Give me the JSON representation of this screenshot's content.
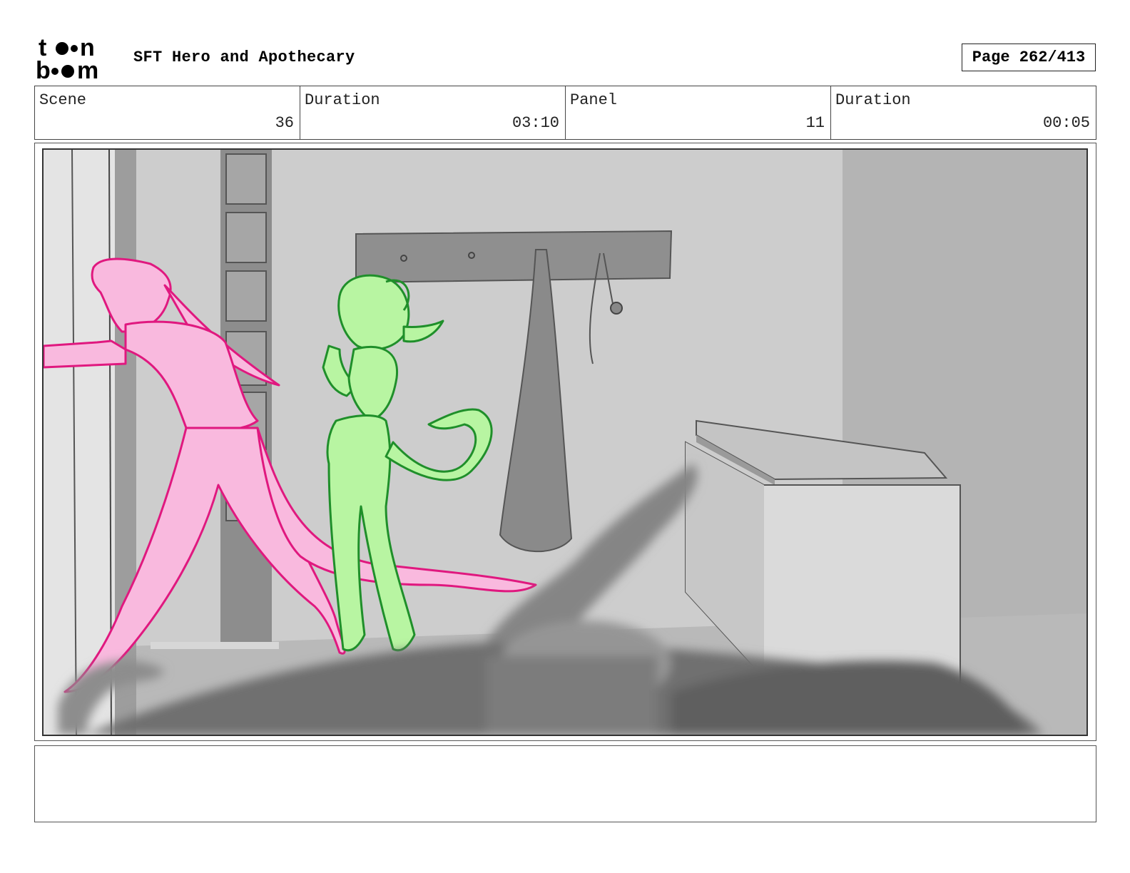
{
  "header": {
    "logo_text": "toon boom",
    "project_title": "SFT Hero and Apothecary",
    "page_label": "Page 262/413"
  },
  "info": {
    "scene_label": "Scene",
    "scene_value": "36",
    "scene_duration_label": "Duration",
    "scene_duration_value": "03:10",
    "panel_label": "Panel",
    "panel_value": "11",
    "panel_duration_label": "Duration",
    "panel_duration_value": "00:05"
  },
  "panel": {
    "colors": {
      "character_pink": "#f9b9de",
      "pink_line": "#e0187f",
      "character_green": "#b8f5a2",
      "green_line": "#1f8f2a",
      "wall_gray": "#c9c9c9",
      "foreground_blur": "#7a7a7a"
    }
  },
  "notes": {
    "text": ""
  }
}
